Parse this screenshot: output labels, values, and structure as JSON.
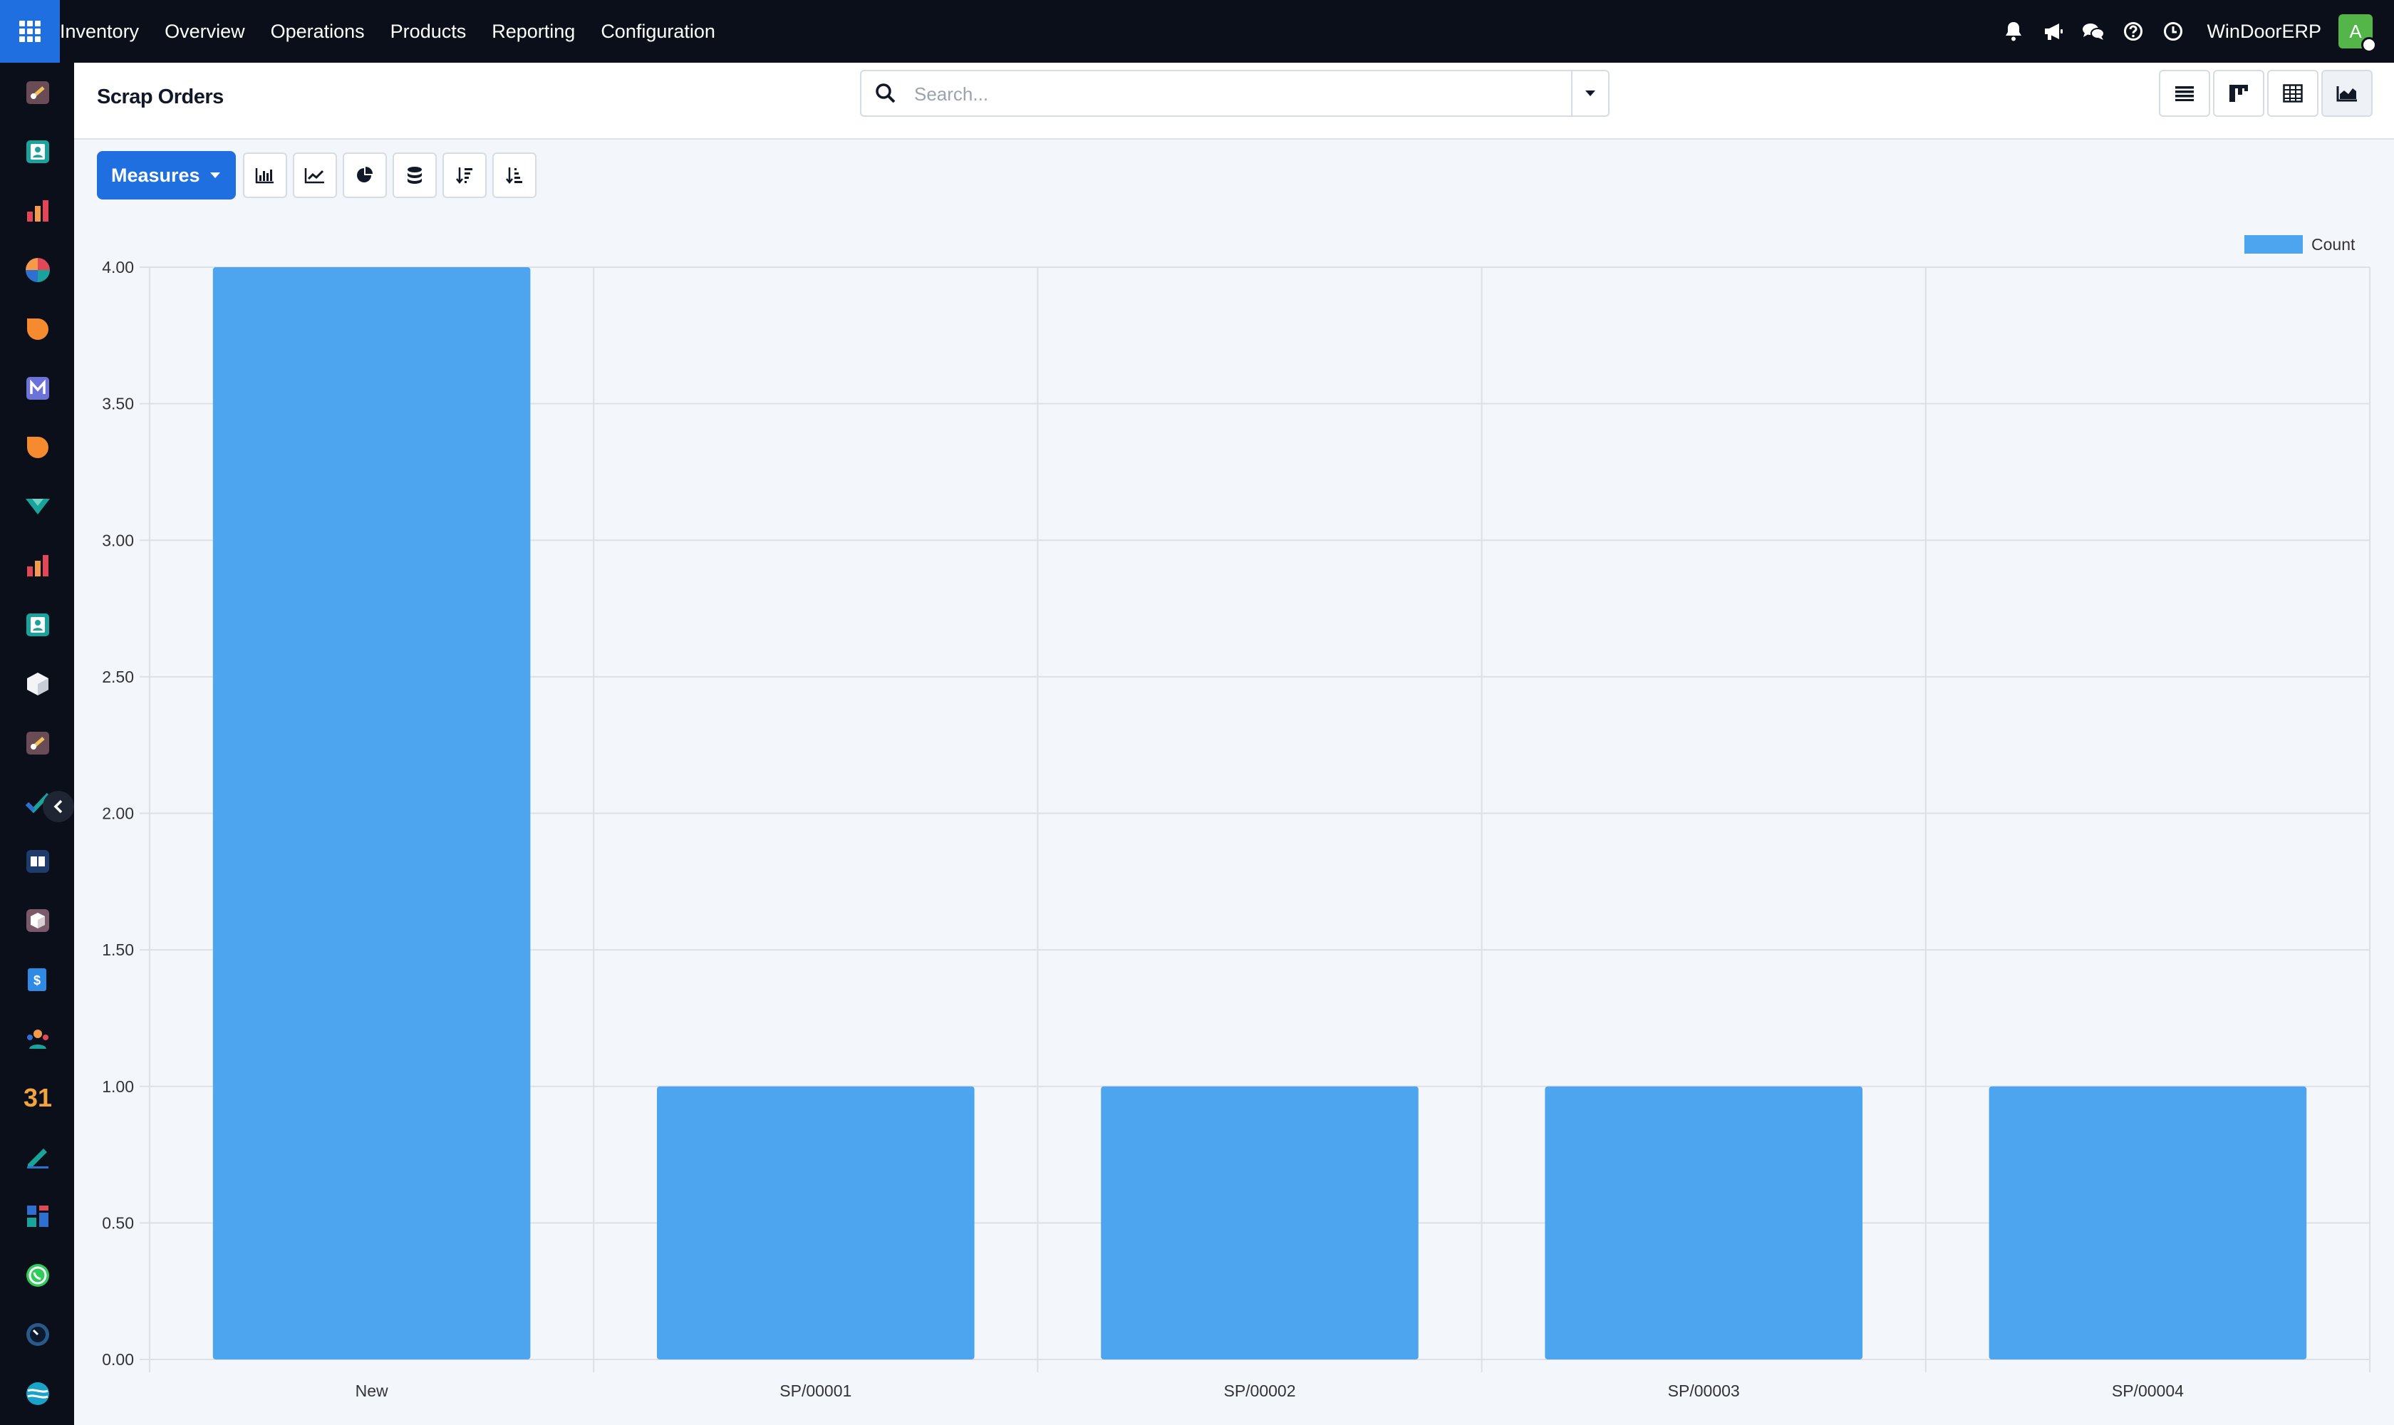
{
  "topbar": {
    "nav": [
      "Inventory",
      "Overview",
      "Operations",
      "Products",
      "Reporting",
      "Configuration"
    ],
    "company": "WinDoorERP",
    "avatar_initial": "A",
    "icons": [
      "bell-icon",
      "megaphone-icon",
      "chat-icon",
      "help-icon",
      "clock-icon"
    ]
  },
  "sidebar": {
    "apps": [
      "barcode-app-icon",
      "contacts-app-icon",
      "reporting-app-icon",
      "planning-app-icon",
      "discuss-app-icon",
      "email-marketing-app-icon",
      "live-chat-app-icon",
      "survey-app-icon",
      "dashboard-app-icon",
      "employees-app-icon",
      "inventory-app-icon",
      "barcode-app-icon-2",
      "project-app-icon",
      "knowledge-app-icon",
      "product-app-icon",
      "invoicing-app-icon",
      "team-app-icon",
      "calendar-app-icon",
      "sign-app-icon",
      "spreadsheet-app-icon",
      "whatsapp-app-icon",
      "timesheet-app-icon",
      "website-app-icon"
    ],
    "calendar_day": "31"
  },
  "header": {
    "title": "Scrap Orders",
    "search_placeholder": "Search..."
  },
  "toolbar": {
    "measures_label": "Measures",
    "tools": [
      "bar-chart-icon",
      "line-chart-icon",
      "pie-chart-icon",
      "stacked-icon",
      "sort-descending-icon",
      "sort-ascending-icon"
    ]
  },
  "views": [
    "list-view-icon",
    "kanban-view-icon",
    "pivot-view-icon",
    "graph-view-icon"
  ],
  "chart_data": {
    "type": "bar",
    "categories": [
      "New",
      "SP/00001",
      "SP/00002",
      "SP/00003",
      "SP/00004"
    ],
    "series": [
      {
        "name": "Count",
        "values": [
          4,
          1,
          1,
          1,
          1
        ],
        "color": "#4da5f0"
      }
    ],
    "ylim": [
      0,
      4
    ],
    "yticks": [
      "0.00",
      "0.50",
      "1.00",
      "1.50",
      "2.00",
      "2.50",
      "3.00",
      "3.50",
      "4.00"
    ],
    "grid": true,
    "legend": "top-right"
  }
}
